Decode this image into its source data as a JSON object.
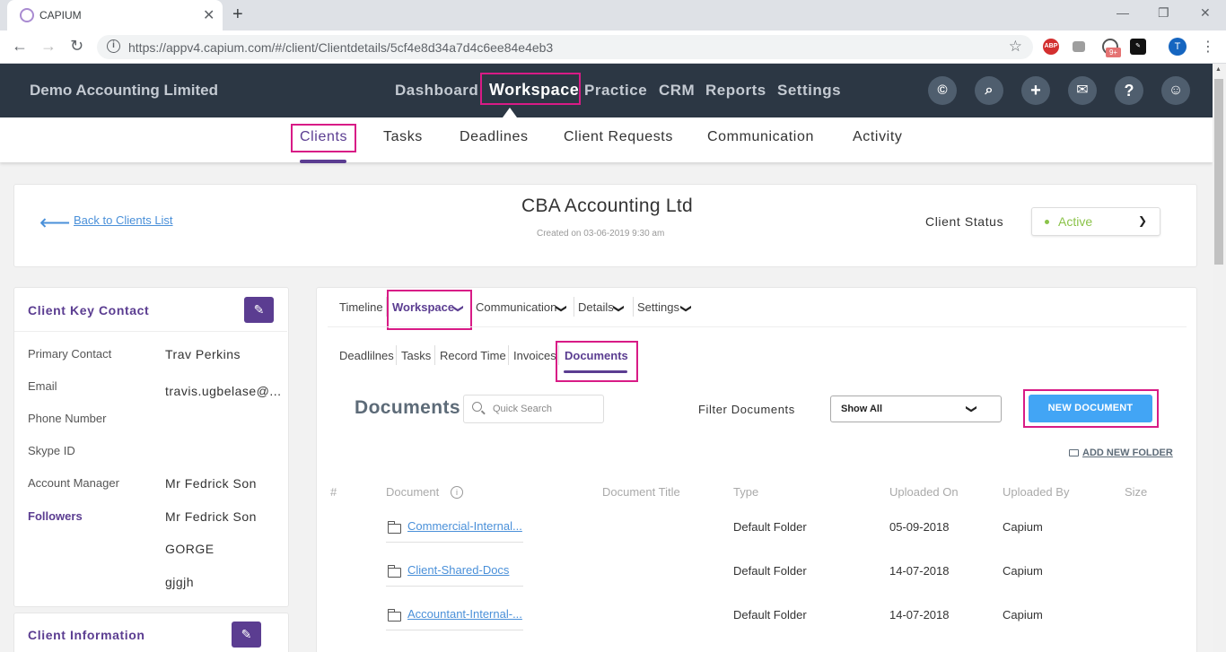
{
  "browser": {
    "tab_title": "CAPIUM",
    "url": "https://appv4.capium.com/#/client/Clientdetails/5cf4e8d34a7d4c6ee84e4eb3",
    "ext_abp": "ABP",
    "ext_badge": "9+",
    "profile_initial": "T"
  },
  "header": {
    "company": "Demo Accounting Limited",
    "nav": [
      "Dashboard",
      "Workspace",
      "Practice",
      "CRM",
      "Reports",
      "Settings"
    ],
    "active_nav": "Workspace",
    "icons": [
      "capium-logo-icon",
      "search-icon",
      "plus-icon",
      "mail-icon",
      "help-icon",
      "user-icon"
    ]
  },
  "subnav": {
    "items": [
      "Clients",
      "Tasks",
      "Deadlines",
      "Client Requests",
      "Communication",
      "Activity"
    ],
    "active": "Clients"
  },
  "client": {
    "back_label": "Back to Clients List",
    "name": "CBA Accounting Ltd",
    "created_on": "Created on 03-06-2019 9:30 am",
    "status_label": "Client Status",
    "status_value": "Active",
    "status_color": "#8bc34a"
  },
  "key_contact": {
    "title": "Client Key Contact",
    "fields": [
      {
        "label": "Primary Contact",
        "value": "Trav Perkins"
      },
      {
        "label": "Email",
        "value": "travis.ugbelase@..."
      },
      {
        "label": "Phone Number",
        "value": ""
      },
      {
        "label": "Skype ID",
        "value": ""
      },
      {
        "label": "Account Manager",
        "value": "Mr Fedrick Son"
      }
    ],
    "followers_label": "Followers",
    "followers": [
      "Mr Fedrick Son",
      "GORGE",
      "gjgjh"
    ]
  },
  "client_info": {
    "title": "Client Information"
  },
  "workspace_tabs": {
    "items": [
      "Timeline",
      "Workspace",
      "Communication",
      "Details",
      "Settings"
    ],
    "active": "Workspace"
  },
  "doc_tabs": {
    "items": [
      "Deadlilnes",
      "Tasks",
      "Record Time",
      "Invoices",
      "Documents"
    ],
    "active": "Documents"
  },
  "documents": {
    "title": "Documents",
    "search_placeholder": "Quick Search",
    "filter_label": "Filter Documents",
    "filter_value": "Show All",
    "new_button": "NEW DOCUMENT",
    "add_folder": "ADD NEW FOLDER",
    "columns": [
      "#",
      "Document",
      "Document Title",
      "Type",
      "Uploaded On",
      "Uploaded By",
      "Size"
    ],
    "rows": [
      {
        "document": "Commercial-Internal...",
        "title": "",
        "type": "Default Folder",
        "uploaded_on": "05-09-2018",
        "uploaded_by": "Capium",
        "size": ""
      },
      {
        "document": "Client-Shared-Docs",
        "title": "",
        "type": "Default Folder",
        "uploaded_on": "14-07-2018",
        "uploaded_by": "Capium",
        "size": ""
      },
      {
        "document": "Accountant-Internal-...",
        "title": "",
        "type": "Default Folder",
        "uploaded_on": "14-07-2018",
        "uploaded_by": "Capium",
        "size": ""
      }
    ]
  },
  "colors": {
    "brand_purple": "#5b3d91",
    "header_bg": "#2c3744",
    "highlight": "#d81b86",
    "button_blue": "#42a5f5",
    "link_blue": "#4a90d9"
  }
}
